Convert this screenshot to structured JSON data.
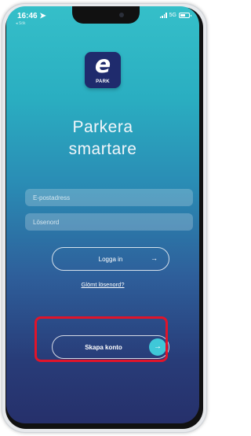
{
  "status_bar": {
    "time": "16:46",
    "carrier": "◂ Sök",
    "network": "5G"
  },
  "logo": {
    "letter": "e",
    "subtext": "PARK"
  },
  "headline": {
    "line1": "Parkera",
    "line2": "smartare"
  },
  "form": {
    "email_placeholder": "E-postadress",
    "password_placeholder": "Lösenord",
    "login_label": "Logga in",
    "forgot_label": "Glömt lösenord?"
  },
  "create_account": {
    "label": "Skapa konto"
  },
  "colors": {
    "highlight": "#e0142a",
    "logo_bg": "#1f2b6d",
    "arrow_circle": "#3fc8d8"
  }
}
